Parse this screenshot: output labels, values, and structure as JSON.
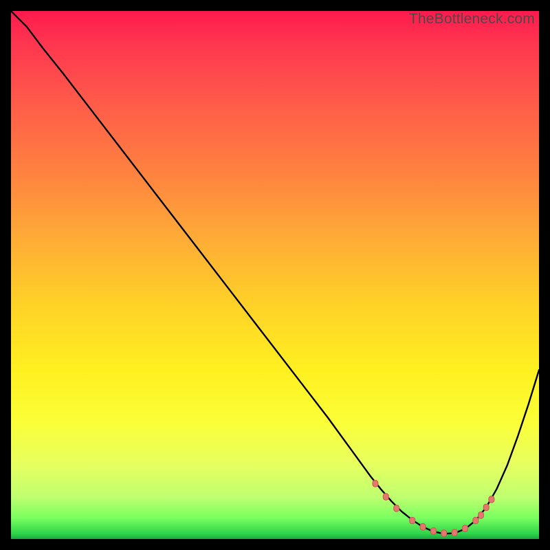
{
  "watermark": "TheBottleneck.com",
  "colors": {
    "marker_fill": "#e6776f",
    "marker_stroke": "#c75a53",
    "curve": "#000000"
  },
  "chart_data": {
    "type": "line",
    "title": "",
    "xlabel": "",
    "ylabel": "",
    "xlim": [
      0,
      100
    ],
    "ylim": [
      0,
      100
    ],
    "series": [
      {
        "name": "bottleneck-curve",
        "x": [
          0,
          3,
          6,
          10,
          15,
          20,
          25,
          30,
          35,
          40,
          45,
          50,
          55,
          60,
          64,
          68,
          70,
          72,
          74,
          76,
          78,
          80,
          82,
          84,
          86,
          88,
          90,
          92,
          94,
          96,
          98,
          100
        ],
        "y": [
          100,
          97,
          93,
          88,
          81.5,
          75,
          68.5,
          62,
          55.5,
          49,
          42.5,
          36,
          29.5,
          23,
          17.5,
          12,
          9.5,
          7.2,
          5.2,
          3.6,
          2.3,
          1.4,
          1.0,
          1.1,
          1.9,
          3.5,
          6.0,
          9.5,
          14.0,
          19.5,
          25.5,
          32.0
        ]
      }
    ],
    "markers": {
      "series": "bottleneck-curve",
      "points": [
        {
          "x": 69,
          "y": 10.5
        },
        {
          "x": 71,
          "y": 8.0
        },
        {
          "x": 73,
          "y": 5.8
        },
        {
          "x": 76,
          "y": 3.5
        },
        {
          "x": 78,
          "y": 2.3
        },
        {
          "x": 80,
          "y": 1.5
        },
        {
          "x": 82,
          "y": 1.1
        },
        {
          "x": 84,
          "y": 1.2
        },
        {
          "x": 86,
          "y": 2.0
        },
        {
          "x": 88,
          "y": 3.5
        },
        {
          "x": 89,
          "y": 4.5
        },
        {
          "x": 90,
          "y": 6.0
        },
        {
          "x": 91,
          "y": 7.5
        }
      ],
      "size": 8
    }
  }
}
